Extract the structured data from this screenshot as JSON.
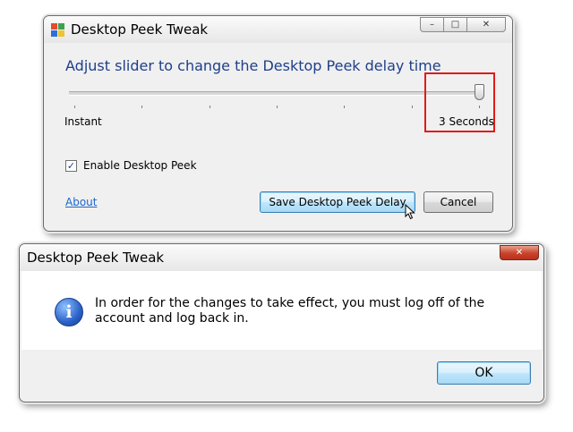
{
  "dialog": {
    "title": "Desktop Peek Tweak",
    "title_buttons": {
      "minimize": "–",
      "maximize": "□",
      "close": "✕"
    },
    "instruction": "Adjust slider to change the Desktop Peek delay time",
    "slider": {
      "min_label": "Instant",
      "max_label": "3 Seconds",
      "value_fraction": 1.0,
      "tick_count": 7
    },
    "checkbox": {
      "label": "Enable Desktop Peek",
      "checked": true,
      "mark": "✓"
    },
    "about_link": "About",
    "save_button": "Save Desktop Peek Delay",
    "cancel_button": "Cancel",
    "highlight_color": "#e11a1a"
  },
  "message_box": {
    "title": "Desktop Peek Tweak",
    "close_button": "✕",
    "icon": "info-icon",
    "icon_glyph": "i",
    "message": "In order for the changes to take effect, you must log off of the account and log back in.",
    "ok_button": "OK"
  }
}
